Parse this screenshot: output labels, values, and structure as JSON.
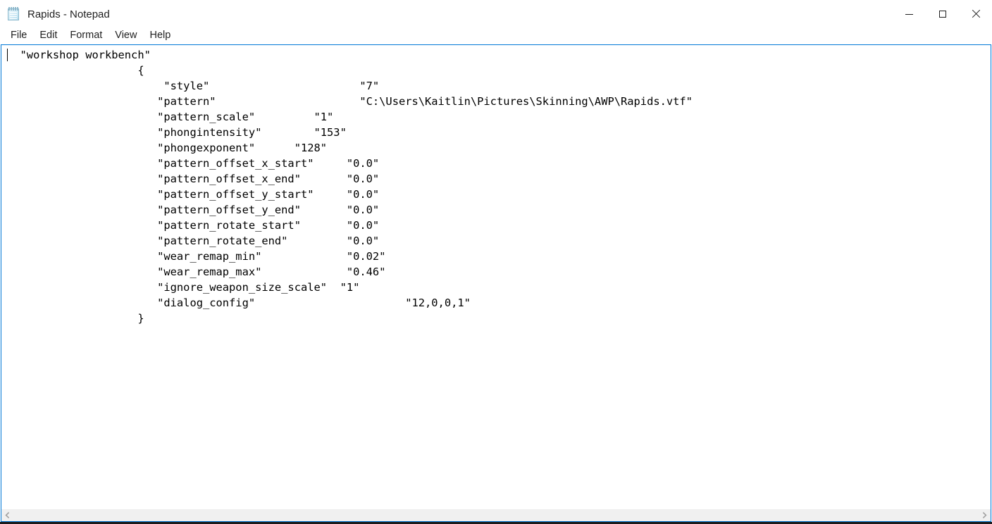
{
  "window": {
    "title": "Rapids - Notepad",
    "icon": "notepad-icon",
    "accent_border": "#0078d7",
    "controls": {
      "minimize": "minimize-icon",
      "maximize": "maximize-icon",
      "close": "close-icon"
    }
  },
  "menubar": {
    "items": [
      {
        "label": "File"
      },
      {
        "label": "Edit"
      },
      {
        "label": "Format"
      },
      {
        "label": "View"
      },
      {
        "label": "Help"
      }
    ]
  },
  "editor": {
    "text": "  \"workshop workbench\"\n                    {\n                        \"style\"                       \"7\"\n                       \"pattern\"                      \"C:\\Users\\Kaitlin\\Pictures\\Skinning\\AWP\\Rapids.vtf\"\n                       \"pattern_scale\"         \"1\"\n                       \"phongintensity\"        \"153\"\n                       \"phongexponent\"      \"128\"\n                       \"pattern_offset_x_start\"     \"0.0\"\n                       \"pattern_offset_x_end\"       \"0.0\"\n                       \"pattern_offset_y_start\"     \"0.0\"\n                       \"pattern_offset_y_end\"       \"0.0\"\n                       \"pattern_rotate_start\"       \"0.0\"\n                       \"pattern_rotate_end\"         \"0.0\"\n                       \"wear_remap_min\"             \"0.02\"\n                       \"wear_remap_max\"             \"0.46\"\n                       \"ignore_weapon_size_scale\"  \"1\"\n                       \"dialog_config\"                       \"12,0,0,1\"\n                    }",
    "lines": [
      {
        "key": "\"workshop workbench\"",
        "value": ""
      },
      {
        "key": "{",
        "value": ""
      },
      {
        "key": "\"style\"",
        "value": "\"7\""
      },
      {
        "key": "\"pattern\"",
        "value": "\"C:\\Users\\Kaitlin\\Pictures\\Skinning\\AWP\\Rapids.vtf\""
      },
      {
        "key": "\"pattern_scale\"",
        "value": "\"1\""
      },
      {
        "key": "\"phongintensity\"",
        "value": "\"153\""
      },
      {
        "key": "\"phongexponent\"",
        "value": "\"128\""
      },
      {
        "key": "\"pattern_offset_x_start\"",
        "value": "\"0.0\""
      },
      {
        "key": "\"pattern_offset_x_end\"",
        "value": "\"0.0\""
      },
      {
        "key": "\"pattern_offset_y_start\"",
        "value": "\"0.0\""
      },
      {
        "key": "\"pattern_offset_y_end\"",
        "value": "\"0.0\""
      },
      {
        "key": "\"pattern_rotate_start\"",
        "value": "\"0.0\""
      },
      {
        "key": "\"pattern_rotate_end\"",
        "value": "\"0.0\""
      },
      {
        "key": "\"wear_remap_min\"",
        "value": "\"0.02\""
      },
      {
        "key": "\"wear_remap_max\"",
        "value": "\"0.46\""
      },
      {
        "key": "\"ignore_weapon_size_scale\"",
        "value": "\"1\""
      },
      {
        "key": "\"dialog_config\"",
        "value": "\"12,0,0,1\""
      },
      {
        "key": "}",
        "value": ""
      }
    ]
  },
  "scrollbar": {
    "left_arrow": "chevron-left-icon",
    "right_arrow": "chevron-right-icon"
  }
}
